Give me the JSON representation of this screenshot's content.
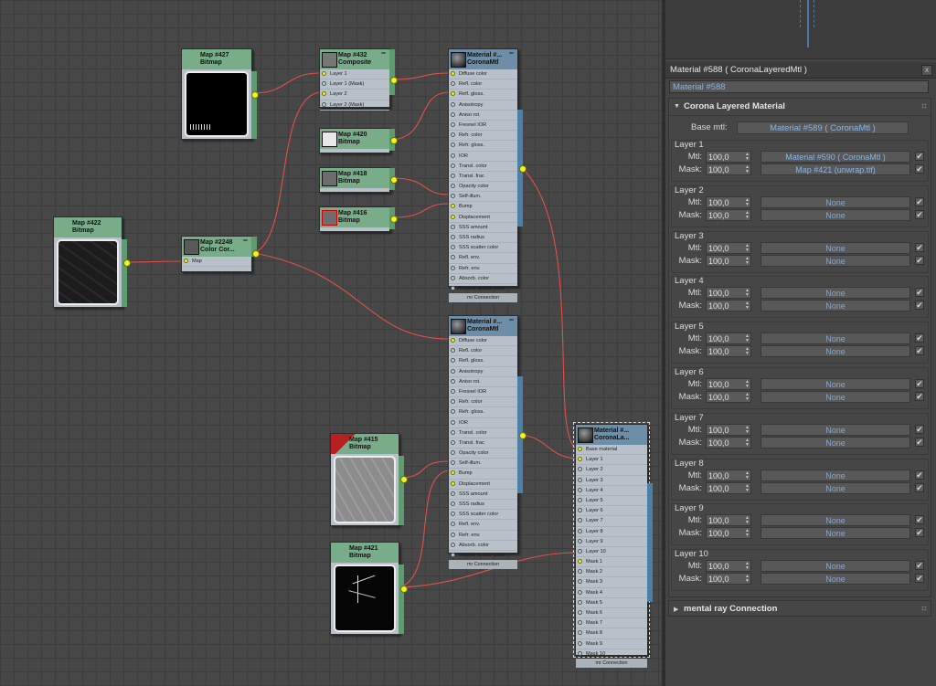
{
  "nodes": {
    "map427": {
      "title": "Map #427",
      "type": "Bitmap"
    },
    "map422": {
      "title": "Map #422",
      "type": "Bitmap"
    },
    "map2248": {
      "title": "Map #2248",
      "type": "Color Cor...",
      "param": "Map"
    },
    "map432": {
      "title": "Map #432",
      "type": "Composite",
      "params": [
        "Layer 1",
        "Layer 1 (Mask)",
        "Layer 2",
        "Layer 2 (Mask)"
      ]
    },
    "map420": {
      "title": "Map #420",
      "type": "Bitmap"
    },
    "map418": {
      "title": "Map #418",
      "type": "Bitmap"
    },
    "map416": {
      "title": "Map #416",
      "type": "Bitmap"
    },
    "map415": {
      "title": "Map #415",
      "type": "Bitmap"
    },
    "map421": {
      "title": "Map #421",
      "type": "Bitmap"
    },
    "mtlA": {
      "title": "Material #...",
      "type": "CoronaMtl"
    },
    "mtlB": {
      "title": "Material #...",
      "type": "CoronaMtl"
    },
    "mtlLayered": {
      "title": "Material #...",
      "type": "CoronaLa..."
    },
    "coronaParams": [
      "Diffuse color",
      "Refl. color",
      "Refl. gloss.",
      "Anisotropy",
      "Aniso rot.",
      "Fresnel IOR",
      "Refr. color",
      "Refr. gloss.",
      "IOR",
      "Transl. color",
      "Transl. frac",
      "Opacity color",
      "Self-illum.",
      "Bump",
      "Displacement",
      "SSS amount",
      "SSS radius",
      "SSS scatter color",
      "Refl. env.",
      "Refr. env.",
      "Absorb. color",
      "Volume scatter color"
    ],
    "layeredParams": [
      "Base material",
      "Layer 1",
      "Layer 2",
      "Layer 3",
      "Layer 4",
      "Layer 5",
      "Layer 6",
      "Layer 7",
      "Layer 8",
      "Layer 9",
      "Layer 10",
      "Mask 1",
      "Mask 2",
      "Mask 3",
      "Mask 4",
      "Mask 5",
      "Mask 6",
      "Mask 7",
      "Mask 8",
      "Mask 9",
      "Mask 10"
    ],
    "footer": "mr Connection"
  },
  "panel": {
    "title": "Material #588  ( CoronaLayeredMtl )",
    "close": "x",
    "name_value": "Material #588",
    "rollout_title": "Corona Layered Material",
    "base_label": "Base mtl:",
    "base_value": "Material #589  ( CoronaMtl )",
    "mtl_label": "Mtl:",
    "mask_label": "Mask:",
    "layers": [
      {
        "label": "Layer 1",
        "mtl_amount": "100,0",
        "mtl": "Material #590  ( CoronaMtl )",
        "mask_amount": "100,0",
        "mask": "Map #421 (unwrap.tif)"
      },
      {
        "label": "Layer 2",
        "mtl_amount": "100,0",
        "mtl": "None",
        "mask_amount": "100,0",
        "mask": "None"
      },
      {
        "label": "Layer 3",
        "mtl_amount": "100,0",
        "mtl": "None",
        "mask_amount": "100,0",
        "mask": "None"
      },
      {
        "label": "Layer 4",
        "mtl_amount": "100,0",
        "mtl": "None",
        "mask_amount": "100,0",
        "mask": "None"
      },
      {
        "label": "Layer 5",
        "mtl_amount": "100,0",
        "mtl": "None",
        "mask_amount": "100,0",
        "mask": "None"
      },
      {
        "label": "Layer 6",
        "mtl_amount": "100,0",
        "mtl": "None",
        "mask_amount": "100,0",
        "mask": "None"
      },
      {
        "label": "Layer 7",
        "mtl_amount": "100,0",
        "mtl": "None",
        "mask_amount": "100,0",
        "mask": "None"
      },
      {
        "label": "Layer 8",
        "mtl_amount": "100,0",
        "mtl": "None",
        "mask_amount": "100,0",
        "mask": "None"
      },
      {
        "label": "Layer 9",
        "mtl_amount": "100,0",
        "mtl": "None",
        "mask_amount": "100,0",
        "mask": "None"
      },
      {
        "label": "Layer 10",
        "mtl_amount": "100,0",
        "mtl": "None",
        "mask_amount": "100,0",
        "mask": "None"
      }
    ],
    "mr_title": "mental ray Connection"
  },
  "colors": {
    "map_header": "#79ad8a",
    "mtl_header": "#6d8ea6",
    "wire": "#e0504a",
    "socket_active": "#eef32c",
    "link_text": "#8ab4e6"
  },
  "icons": {
    "checkbox": "checkmark-icon",
    "spinner": "spinner-arrows-icon",
    "rollout": "rollout-triangle-icon"
  }
}
